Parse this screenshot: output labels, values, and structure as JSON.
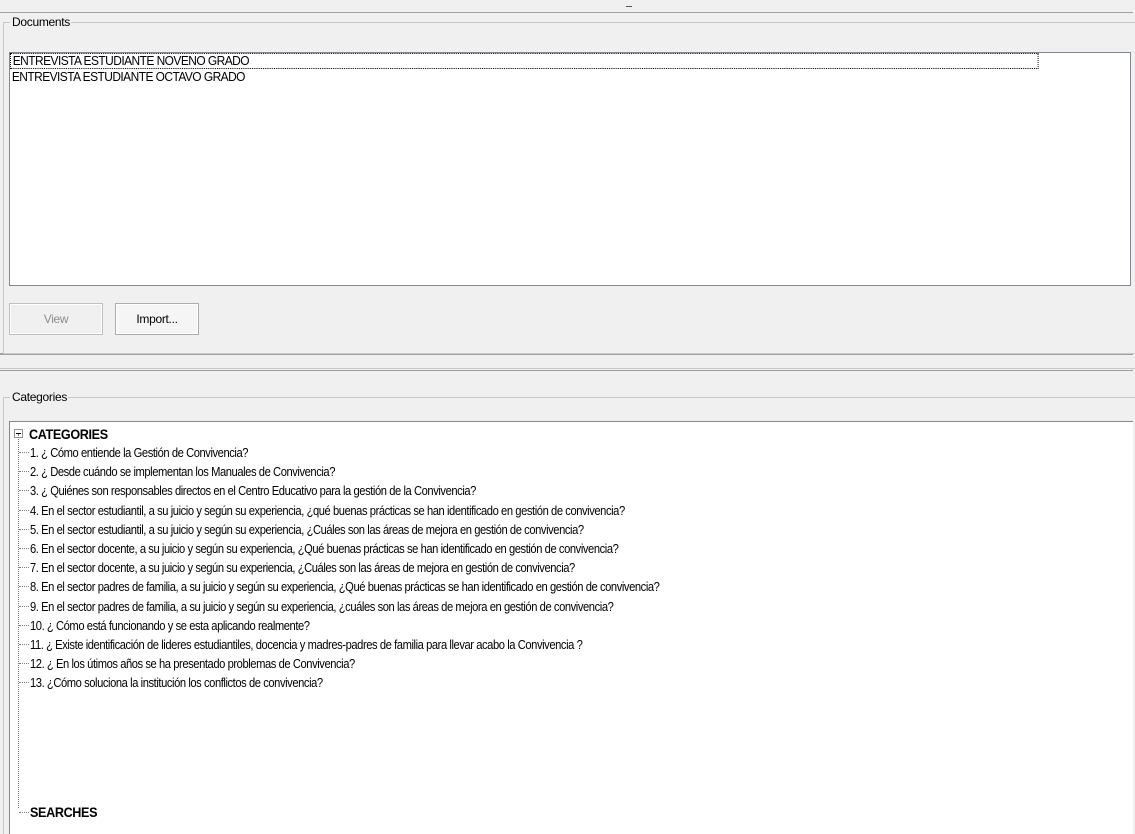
{
  "documents": {
    "group_label": "Documents",
    "items": [
      "ENTREVISTA ESTUDIANTE NOVENO GRADO",
      "ENTREVISTA ESTUDIANTE OCTAVO GRADO"
    ],
    "view_label": "View",
    "import_label": "Import..."
  },
  "categories": {
    "group_label": "Categories",
    "root_label": "CATEGORIES",
    "items": [
      "1. ¿ Cómo entiende la Gestión de Convivencia?",
      "2. ¿ Desde cuándo se implementan los Manuales de Convivencia?",
      "3. ¿ Quiénes son responsables directos en el Centro Educativo para la gestión de la Convivencia?",
      "4. En el sector estudiantil, a su juicio y según su experiencia, ¿qué buenas prácticas se han identificado en gestión de convivencia?",
      " 5. En el sector estudiantil, a su juicio y según su experiencia, ¿Cuáles son las áreas de mejora en gestión de convivencia?",
      "6. En el sector docente, a su juicio y según su experiencia, ¿Qué buenas prácticas se han identificado en gestión de convivencia?",
      "7. En el sector docente, a su juicio y según su experiencia, ¿Cuáles son las áreas de mejora en gestión de convivencia?",
      "8. En el sector padres de familia, a su juicio y según su experiencia, ¿Qué buenas prácticas se han identificado en gestión de convivencia?",
      "9. En el sector padres de familia, a su juicio y según su experiencia, ¿cuáles son las áreas de mejora en gestión de convivencia?",
      "10. ¿ Cómo está funcionando y se esta aplicando realmente?",
      "11. ¿ Existe identificación de lideres estudiantiles, docencia y madres-padres de familia para llevar acabo la Convivencia ?",
      "12. ¿ En los útimos años se ha presentado problemas de Convivencia?",
      "13. ¿Cómo soluciona la institución los conflictos de convivencia?"
    ],
    "searches_label": "SEARCHES"
  }
}
